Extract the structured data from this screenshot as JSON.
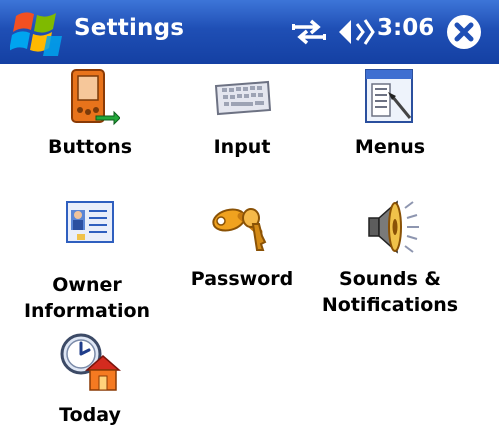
{
  "titlebar": {
    "title": "Settings",
    "time": "3:06"
  },
  "icons": {
    "start": "windows-flag-icon",
    "connectivity": "connectivity-arrows-icon",
    "volume": "speaker-volume-icon",
    "close": "close-icon"
  },
  "items": [
    {
      "label": "Buttons",
      "icon": "pda-buttons-icon"
    },
    {
      "label": "Input",
      "icon": "keyboard-icon"
    },
    {
      "label": "Menus",
      "icon": "menu-window-icon"
    },
    {
      "label_lines": [
        "Owner",
        "Information"
      ],
      "icon": "owner-card-icon"
    },
    {
      "label": "Password",
      "icon": "keys-icon"
    },
    {
      "label_lines": [
        "Sounds &",
        "Notifications"
      ],
      "icon": "speaker-icon"
    },
    {
      "label": "Today",
      "icon": "clock-home-icon"
    }
  ]
}
